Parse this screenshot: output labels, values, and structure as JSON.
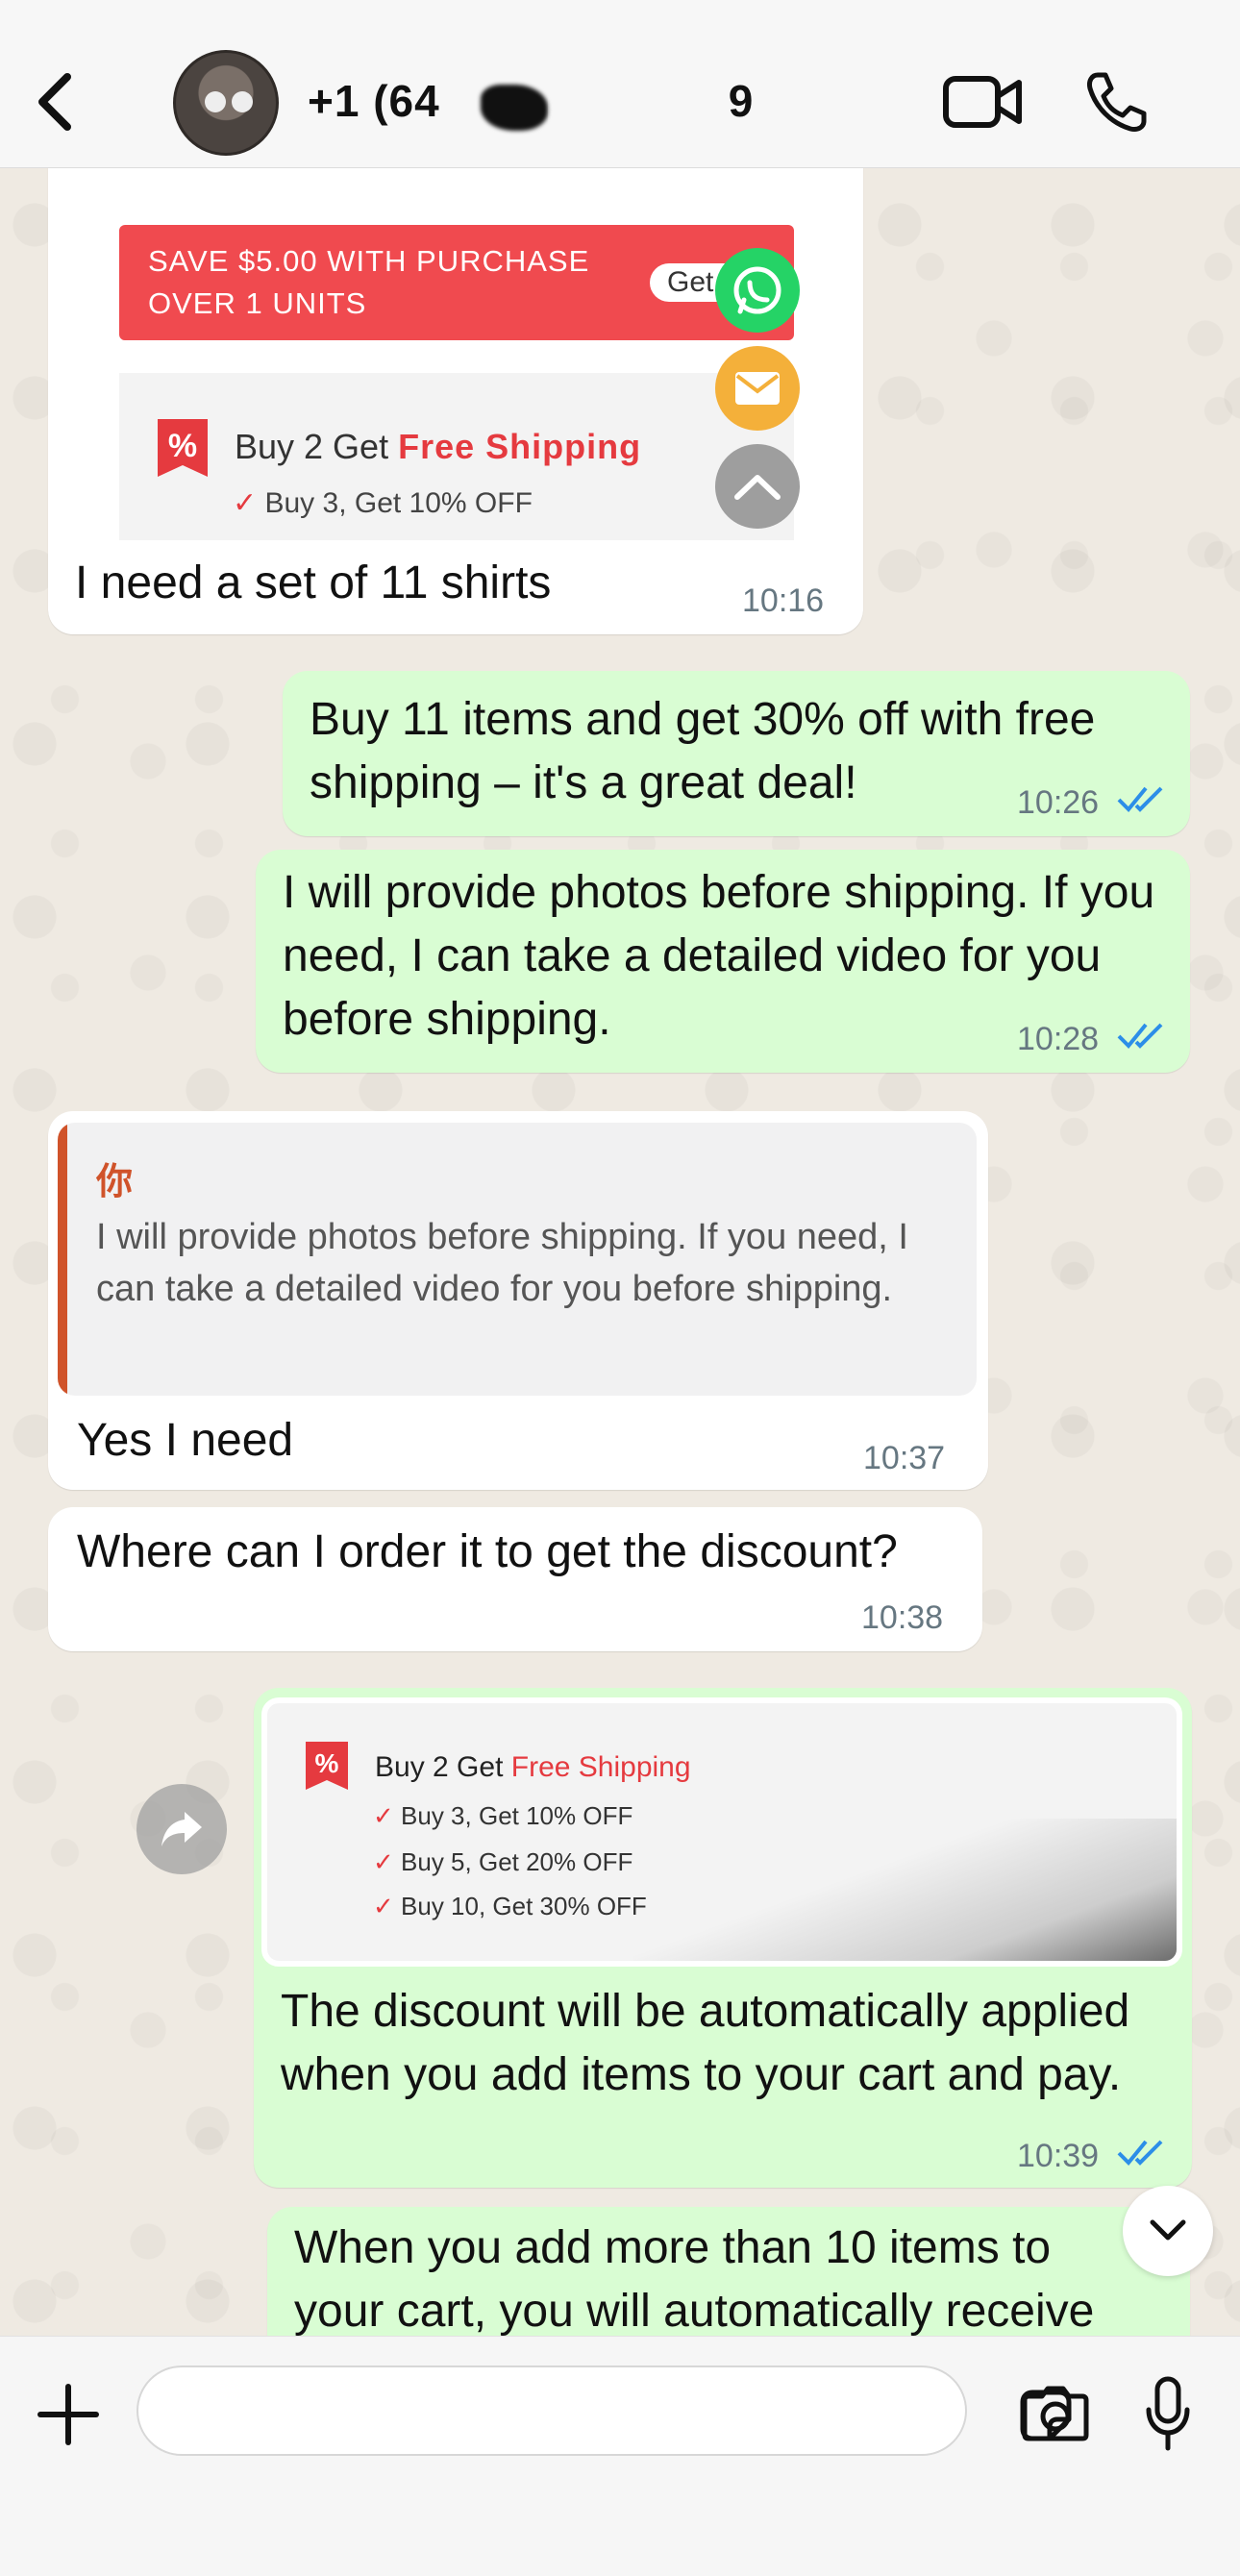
{
  "header": {
    "contact_name": "+1 (64",
    "contact_name_tail": "9"
  },
  "messages": [
    {
      "direction": "in",
      "promo": {
        "banner_line1": "SAVE $5.00 WITH PURCHASE",
        "banner_line2": "OVER 1 UNITS",
        "get_label": "Get",
        "tag": "%",
        "headline_prefix": "Buy 2 Get ",
        "headline_highlight": "Free Shipping",
        "sub": "Buy 3, Get 10% OFF",
        "check": "✓"
      },
      "text": "I need a set of 11 shirts",
      "time": "10:16"
    },
    {
      "direction": "out",
      "text": "Buy 11 items and get 30% off with free shipping – it's a great deal!",
      "time": "10:26"
    },
    {
      "direction": "out",
      "text": "I will provide photos before shipping. If you need, I can take a detailed video for you before shipping.",
      "time": "10:28"
    },
    {
      "direction": "in",
      "quote": {
        "author": "你",
        "text": "I will provide photos before shipping. If you need, I can take a detailed video for you before shipping."
      },
      "text": "Yes I need",
      "time": "10:37"
    },
    {
      "direction": "in",
      "text": "Where can I order it to get the discount?",
      "time": "10:38"
    },
    {
      "direction": "out",
      "card": {
        "tag": "%",
        "headline_prefix": "Buy 2 Get ",
        "headline_highlight": "Free Shipping",
        "rows": [
          "Buy 3, Get 10% OFF",
          "Buy 5, Get 20% OFF",
          "Buy 10, Get 30% OFF"
        ],
        "check": "✓"
      },
      "text": "The discount will be automatically applied when you add items to your cart and pay.",
      "time": "10:39"
    },
    {
      "direction": "out",
      "text": "When you add more than 10 items to your cart, you will automatically receive"
    }
  ],
  "composer": {
    "value": "",
    "placeholder": ""
  },
  "colors": {
    "incoming_bubble": "#ffffff",
    "outgoing_bubble": "#d9fdd3",
    "read_ticks": "#2c8ee8",
    "promo_red": "#f04a4f",
    "whatsapp_green": "#25d366",
    "mail_orange": "#f4b03a",
    "quote_accent": "#d0532a"
  },
  "icons": [
    "back-chevron-icon",
    "video-camera-icon",
    "phone-icon",
    "whatsapp-icon",
    "mail-icon",
    "scroll-up-icon",
    "forward-icon",
    "chevron-down-icon",
    "plus-icon",
    "sticker-icon",
    "camera-icon",
    "microphone-icon"
  ]
}
